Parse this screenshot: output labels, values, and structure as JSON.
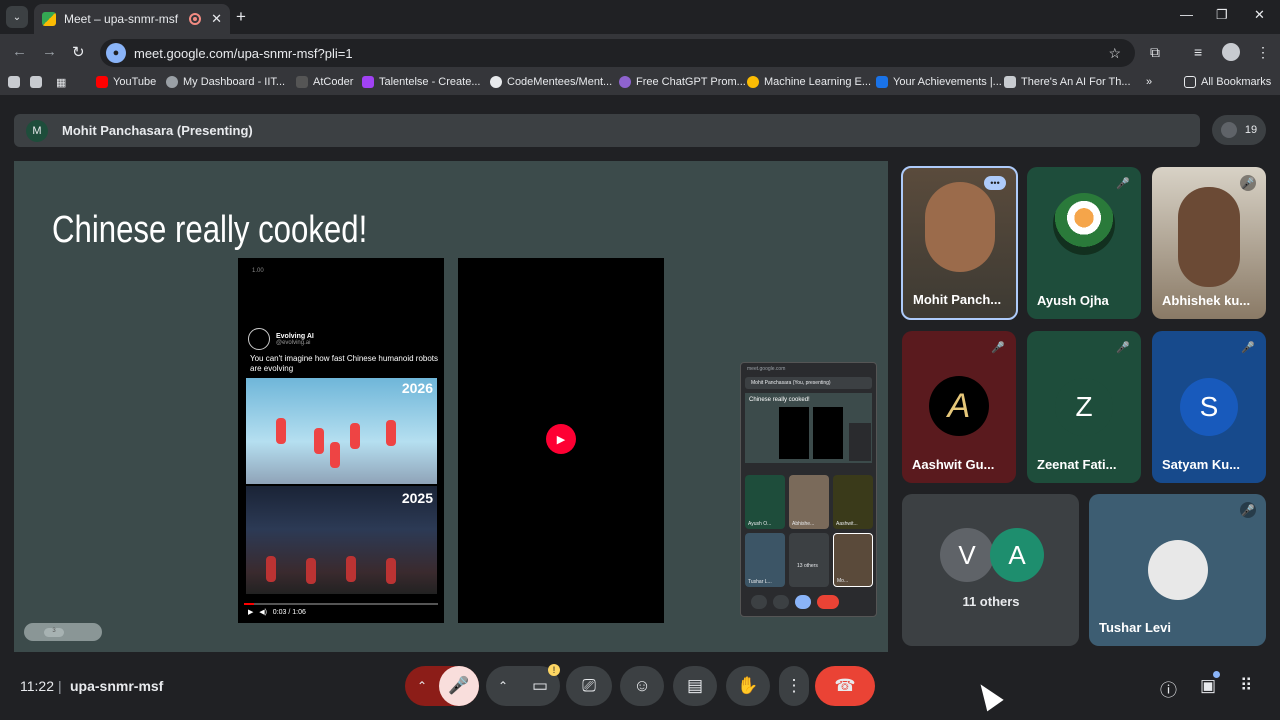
{
  "browser": {
    "tab_title": "Meet – upa-snmr-msf",
    "url": "meet.google.com/upa-snmr-msf?pli=1",
    "bookmarks": [
      "YouTube",
      "My Dashboard - IIT...",
      "AtCoder",
      "Talentelse - Create...",
      "CodeMentees/Ment...",
      "Free ChatGPT Prom...",
      "Machine Learning E...",
      "Your Achievements |...",
      "There's An AI For Th...",
      "»",
      "All Bookmarks"
    ]
  },
  "presenter_bar": {
    "avatar_letter": "M",
    "name": "Mohit Panchasara (Presenting)"
  },
  "participant_count": "19",
  "slide": {
    "title": "Chinese really cooked!",
    "video1": {
      "timestamp": "1.00",
      "account_name": "Evolving AI",
      "account_handle": "@evolving.ai",
      "caption": "You can't imagine how fast Chinese humanoid robots are evolving",
      "year_top": "2026",
      "year_bottom": "2025",
      "player_time": "0:03 / 1:06",
      "progress": 0.05
    },
    "mini_preview": {
      "url": "meet.google.com",
      "presenting": "Mohit Panchasara (You, presenting)",
      "slide_title": "Chinese really cooked!",
      "tiles": [
        "Ayush O...",
        "Abhishe...",
        "Aashwit...",
        "Tushar L...",
        "13 others",
        "Mo..."
      ]
    },
    "page_indicator": "3"
  },
  "participants": [
    {
      "name": "Mohit Panch...",
      "muted": false
    },
    {
      "name": "Ayush Ojha",
      "muted": true
    },
    {
      "name": "Abhishek ku...",
      "muted": true
    },
    {
      "name": "Aashwit Gu...",
      "muted": true
    },
    {
      "name": "Zeenat Fati...",
      "muted": true,
      "letter": "Z"
    },
    {
      "name": "Satyam Ku...",
      "muted": true,
      "letter": "S"
    },
    {
      "name": "Tushar Levi",
      "muted": true
    }
  ],
  "others": {
    "letters": [
      "V",
      "A"
    ],
    "label": "11 others"
  },
  "footer": {
    "time": "11:22",
    "meeting_code": "upa-snmr-msf"
  },
  "colors": {
    "end_call": "#ea4335",
    "mic_off_bg": "#f9dedc",
    "muted_mic": "#f28b82",
    "satyam": "#185abc",
    "zeenat": "#1e4d3b",
    "others_a": "#1e8e6e"
  }
}
